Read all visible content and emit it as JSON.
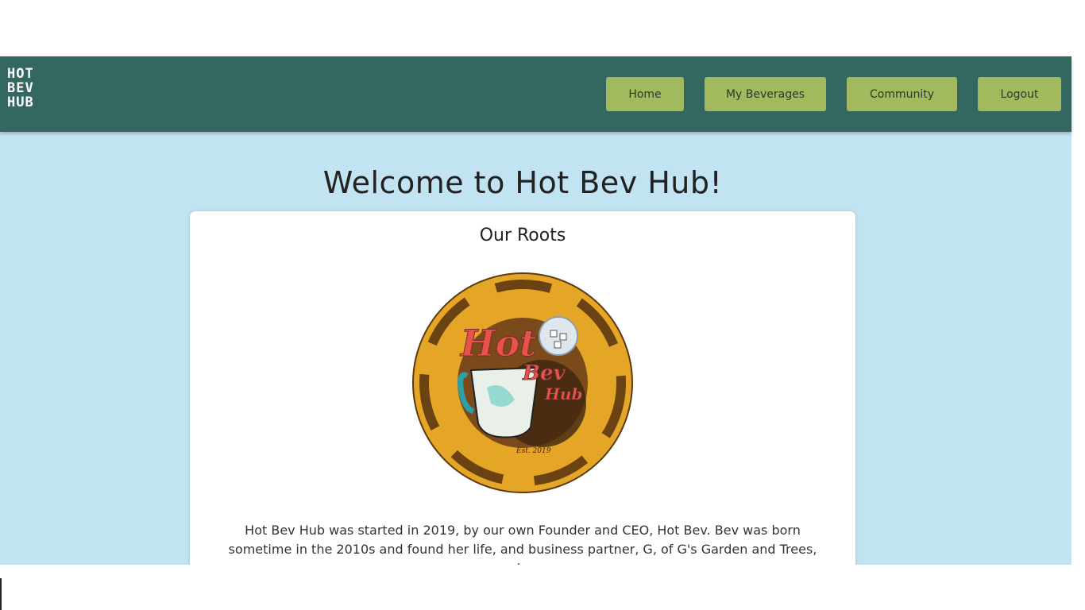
{
  "brand": {
    "line1": "HOT",
    "line2": "BEV",
    "line3": "HUB"
  },
  "nav": {
    "home": "Home",
    "my_beverages": "My Beverages",
    "community": "Community",
    "logout": "Logout"
  },
  "welcome_heading": "Welcome to Hot Bev Hub!",
  "roots": {
    "title": "Our Roots",
    "logo_text_hot": "Hot",
    "logo_text_bev": "Bev",
    "logo_text_hub": "Hub",
    "logo_est": "Est. 2019",
    "paragraph": "Hot Bev Hub was started in 2019, by our own Founder and CEO, Hot Bev. Bev was born sometime in the 2010s and found her life, and business partner, G, of G's Garden and Trees, in"
  },
  "colors": {
    "navbar": "#33675f",
    "nav_button": "#a3b95e",
    "page_background": "#c1e3f2",
    "card": "#ffffff",
    "logo_gold": "#e5a526",
    "logo_brown": "#6b4211",
    "logo_text": "#e5534b"
  }
}
